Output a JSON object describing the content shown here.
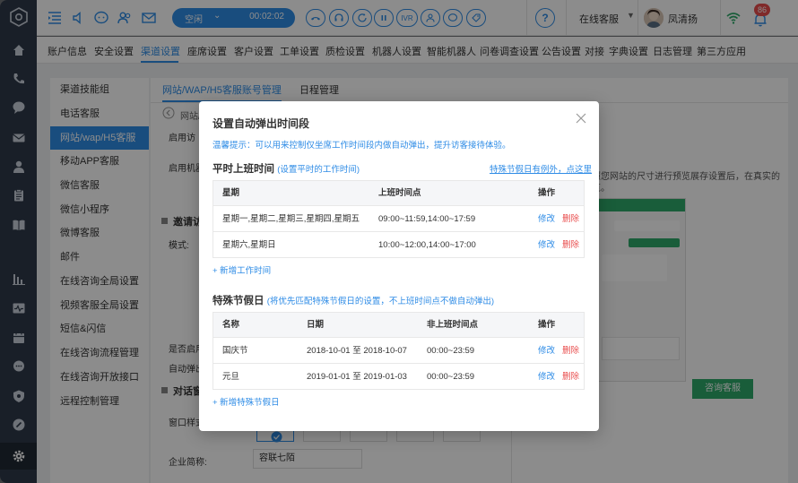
{
  "topbar": {
    "call_status": "空闲",
    "call_timer": "00:02:02",
    "ivr_label": "IVR",
    "help_glyph": "?",
    "agent_status": "在线客服",
    "user_name": "凤清扬",
    "notification_count": "86"
  },
  "nav_tabs": [
    {
      "label": "账户信息"
    },
    {
      "label": "安全设置"
    },
    {
      "label": "渠道设置"
    },
    {
      "label": "座席设置"
    },
    {
      "label": "客户设置"
    },
    {
      "label": "工单设置"
    },
    {
      "label": "质检设置"
    },
    {
      "label": "机器人设置"
    },
    {
      "label": "智能机器人"
    },
    {
      "label": "问卷调查设置"
    },
    {
      "label": "公告设置"
    },
    {
      "label": "对接"
    },
    {
      "label": "字典设置"
    },
    {
      "label": "日志管理"
    },
    {
      "label": "第三方应用"
    }
  ],
  "sidebar": {
    "items": [
      {
        "label": "渠道技能组"
      },
      {
        "label": "电话客服"
      },
      {
        "label": "网站/wap/H5客服"
      },
      {
        "label": "移动APP客服"
      },
      {
        "label": "微信客服"
      },
      {
        "label": "微信小程序"
      },
      {
        "label": "微博客服"
      },
      {
        "label": "邮件"
      },
      {
        "label": "在线咨询全局设置"
      },
      {
        "label": "视频客服全局设置"
      },
      {
        "label": "短信&闪信"
      },
      {
        "label": "在线咨询流程管理"
      },
      {
        "label": "在线咨询开放接口"
      },
      {
        "label": "远程控制管理"
      }
    ]
  },
  "main": {
    "tabs": [
      {
        "label": "网站/WAP/H5客服账号管理"
      },
      {
        "label": "日程管理"
      }
    ],
    "breadcrumb": "网站/",
    "labels": {
      "l1": "启用访",
      "l2": "启用机器",
      "sec1": "邀请访",
      "mode": "模式:",
      "l3": "是否启用",
      "l4": "自动弹出",
      "sec2": "对话窗",
      "window_style": "窗口样式",
      "company_short": "企业简称:"
    },
    "preview_text": "限制，无法完全按照您网站的尺寸进行预览展存设置后，在真实的网站中进行效果预览。",
    "consult_button": "咨询客服",
    "company_value": "容联七陌"
  },
  "modal": {
    "title": "设置自动弹出时间段",
    "tip": "温馨提示：可以用来控制仅坐席工作时间段内做自动弹出，提升访客接待体验。",
    "work": {
      "heading": "平时上班时间",
      "hint": "(设置平时的工作时间)",
      "exception_link": "特殊节假日有例外，点这里",
      "columns": [
        "星期",
        "上班时间点",
        "操作"
      ],
      "rows": [
        {
          "days": "星期一,星期二,星期三,星期四,星期五",
          "time": "09:00~11:59,14:00~17:59",
          "edit": "修改",
          "del": "删除"
        },
        {
          "days": "星期六,星期日",
          "time": "10:00~12:00,14:00~17:00",
          "edit": "修改",
          "del": "删除"
        }
      ],
      "add_label": "+ 新增工作时间"
    },
    "holiday": {
      "heading": "特殊节假日",
      "hint": "(将优先匹配特殊节假日的设置，不上班时间点不做自动弹出)",
      "columns": [
        "名称",
        "日期",
        "非上班时间点",
        "操作"
      ],
      "rows": [
        {
          "name": "国庆节",
          "date": "2018-10-01 至 2018-10-07",
          "time": "00:00~23:59",
          "edit": "修改",
          "del": "删除"
        },
        {
          "name": "元旦",
          "date": "2019-01-01 至 2019-01-03",
          "time": "00:00~23:59",
          "edit": "修改",
          "del": "删除"
        }
      ],
      "add_label": "+ 新增特殊节假日"
    }
  },
  "colors": {
    "accent": "#2f8ce6",
    "danger": "#e94e4e",
    "rail": "#2f3a4a",
    "green": "#2ea96a"
  }
}
